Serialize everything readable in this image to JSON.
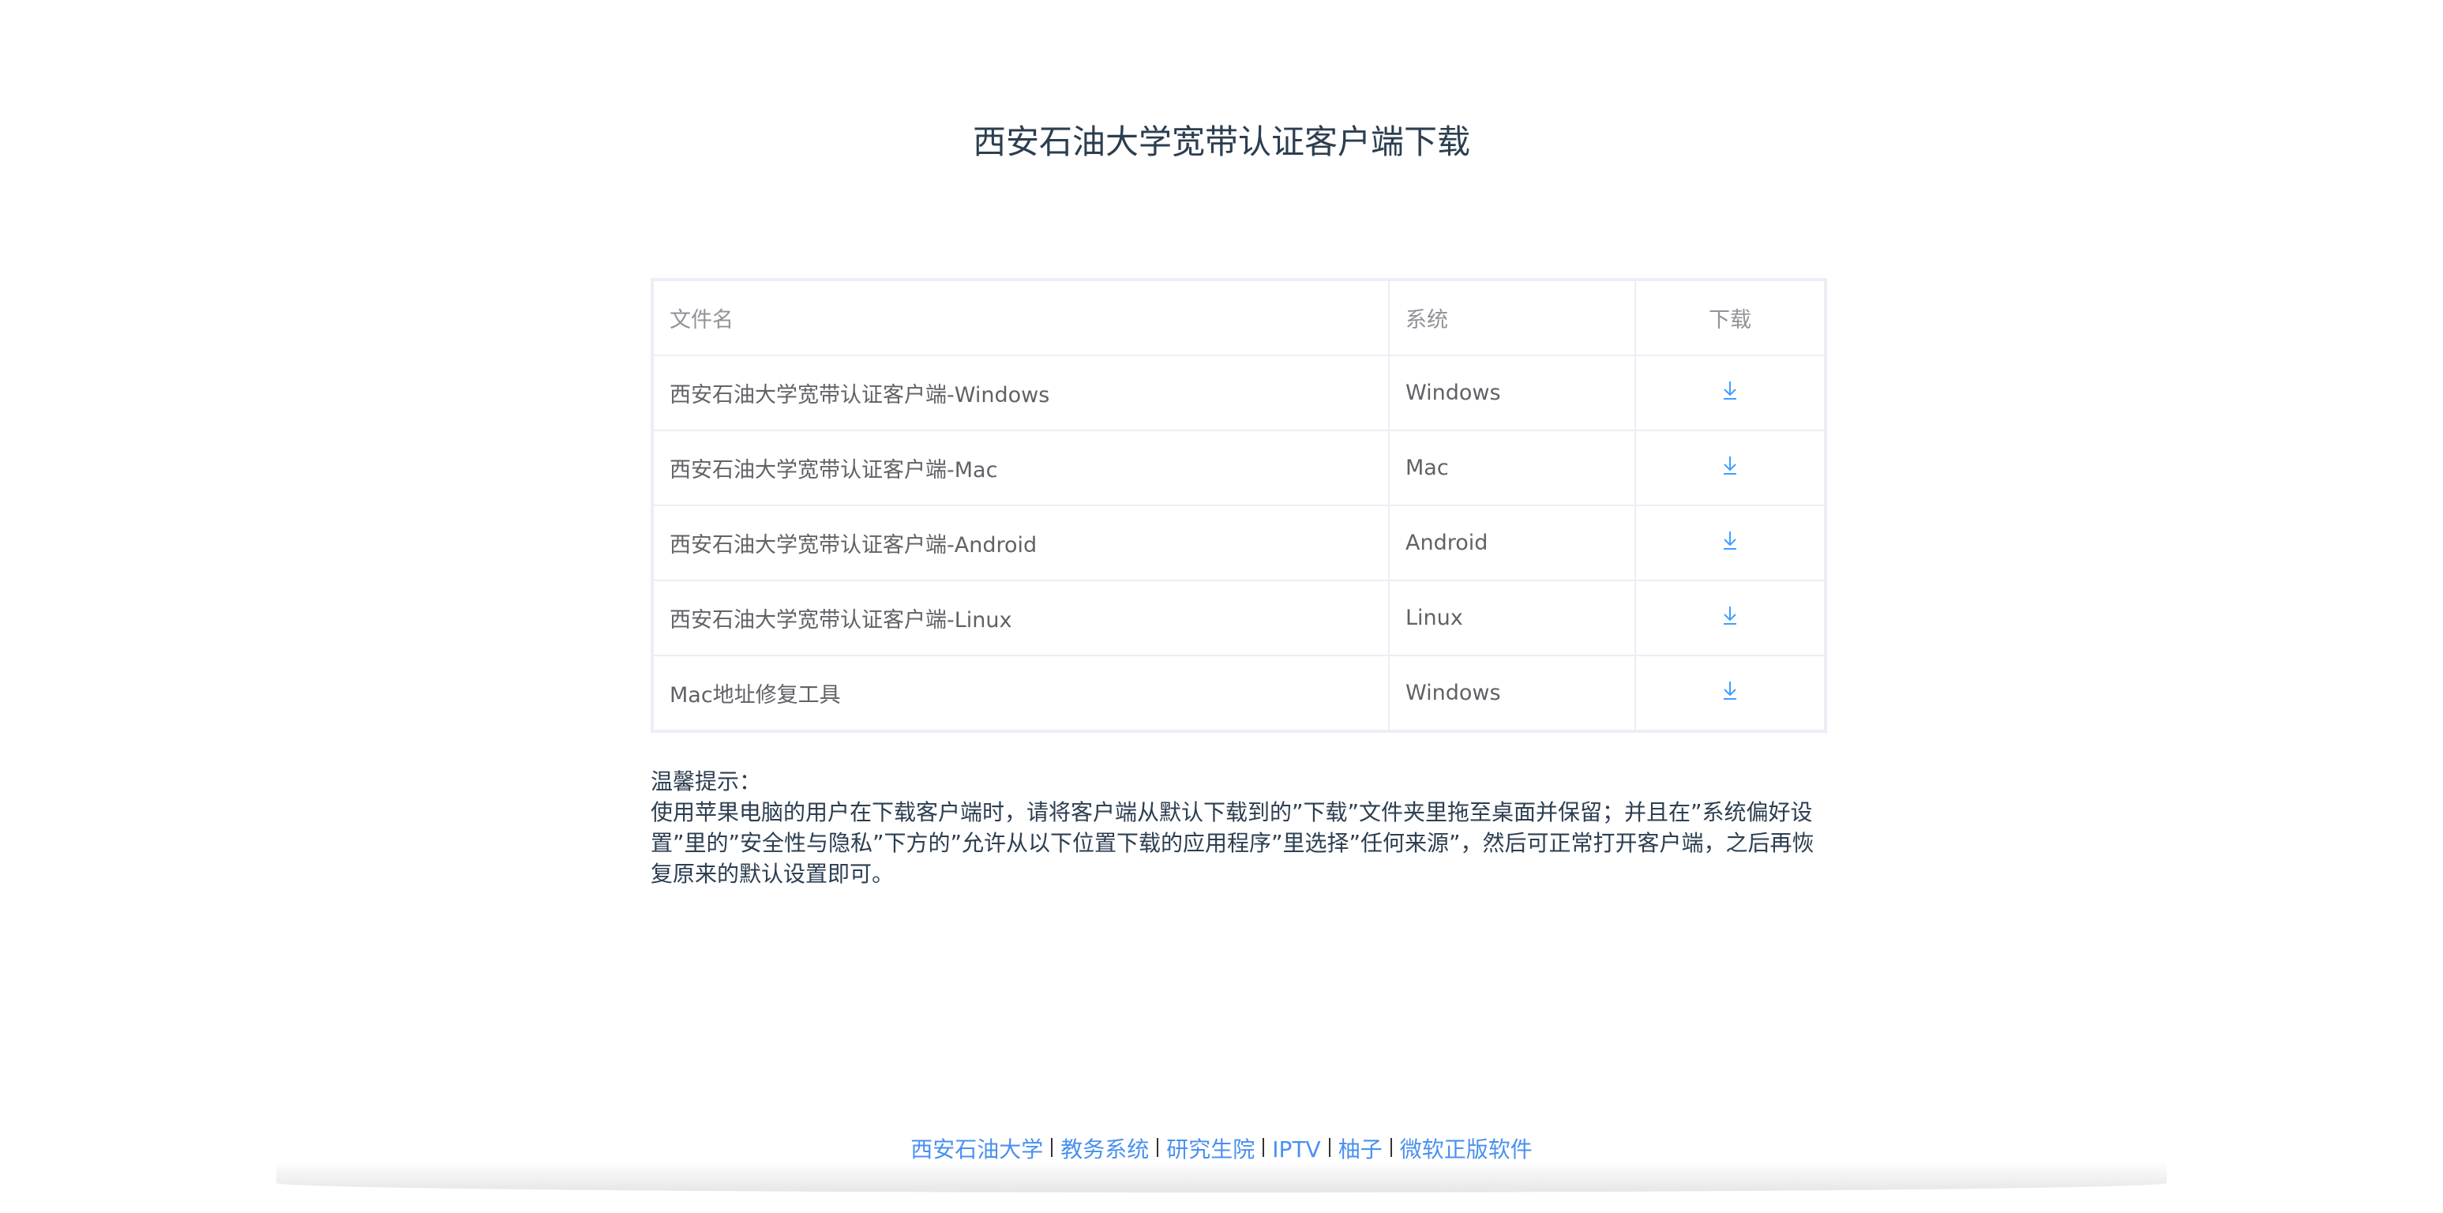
{
  "title": "西安石油大学宽带认证客户端下载",
  "table": {
    "headers": [
      "文件名",
      "系统",
      "下载"
    ],
    "rows": [
      {
        "name": "西安石油大学宽带认证客户端-Windows",
        "system": "Windows"
      },
      {
        "name": "西安石油大学宽带认证客户端-Mac",
        "system": "Mac"
      },
      {
        "name": "西安石油大学宽带认证客户端-Android",
        "system": "Android"
      },
      {
        "name": "西安石油大学宽带认证客户端-Linux",
        "system": "Linux"
      },
      {
        "name": "Mac地址修复工具",
        "system": "Windows"
      }
    ]
  },
  "tip": {
    "heading": "温馨提示：",
    "body": "使用苹果电脑的用户在下载客户端时，请将客户端从默认下载到的”下载”文件夹里拖至桌面并保留；并且在”系统偏好设置”里的”安全性与隐私”下方的”允许从以下位置下载的应用程序”里选择”任何来源”，然后可正常打开客户端，之后再恢复原来的默认设置即可。"
  },
  "footer": {
    "links": [
      "西安石油大学",
      "教务系统",
      "研究生院",
      "IPTV",
      "柚子",
      "微软正版软件"
    ]
  },
  "colors": {
    "accent": "#409eff",
    "link": "#4a90f0"
  }
}
